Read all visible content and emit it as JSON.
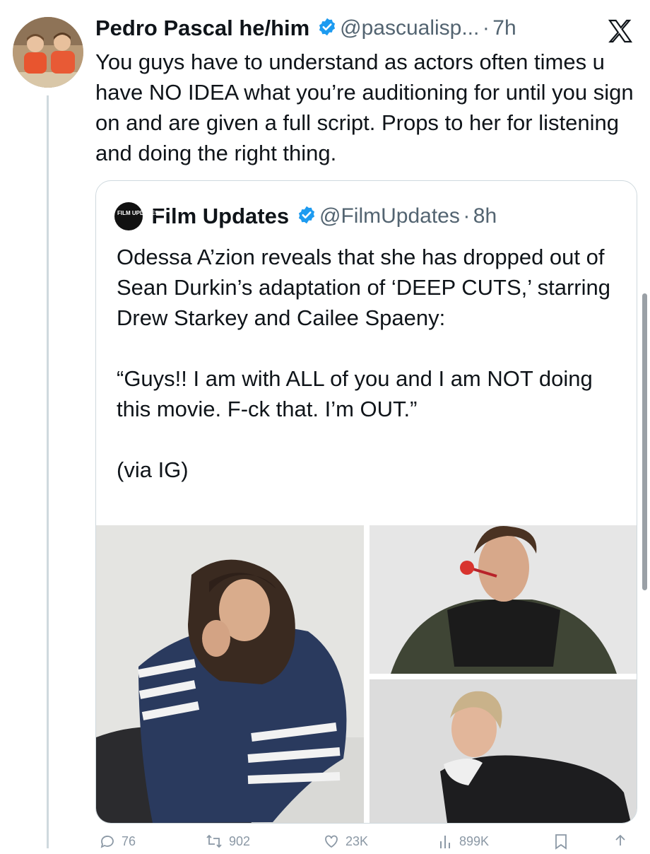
{
  "tweet": {
    "author_name": "Pedro Pascal he/him",
    "handle": "@pascualisp...",
    "separator": "·",
    "time": "7h",
    "text": "You guys have to understand as actors often times u have NO IDEA what you’re auditioning for until you sign on and are given a full script. Props to her for listening and doing the right thing."
  },
  "quote": {
    "author_name": "Film Updates",
    "handle": "@FilmUpdates",
    "separator": "·",
    "time": "8h",
    "avatar_text": "FILM UPDATES",
    "paragraphs": [
      "Odessa A’zion reveals that she has dropped out of Sean Durkin’s adaptation of ‘DEEP CUTS,’ starring Drew Starkey and Cailee Spaeny:",
      "“Guys!! I am with ALL of you and I am NOT doing this movie. F-ck that. I’m OUT.”",
      "(via IG)"
    ]
  },
  "actions": {
    "replies": "76",
    "retweets": "902",
    "likes": "23K",
    "views": "899K"
  },
  "icons": {
    "verified": "verified-badge-icon",
    "x_logo": "x-logo-icon",
    "reply": "reply-icon",
    "retweet": "retweet-icon",
    "like": "heart-icon",
    "views": "views-icon",
    "bookmark": "bookmark-icon",
    "share": "share-icon"
  },
  "colors": {
    "verified_blue": "#1d9bf0",
    "secondary_text": "#536471",
    "border": "#cfd9de"
  }
}
